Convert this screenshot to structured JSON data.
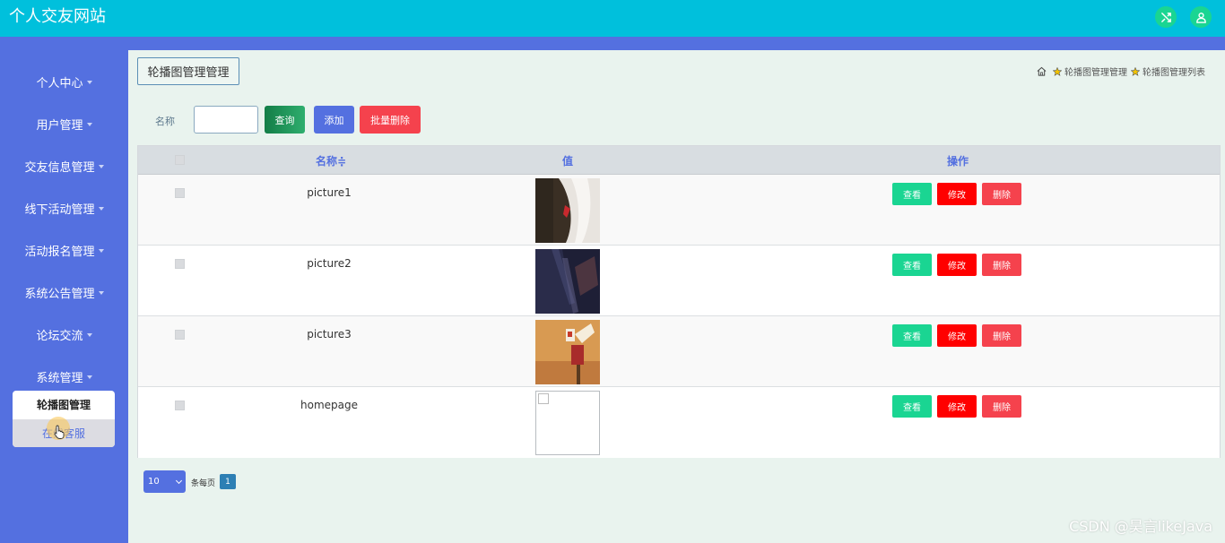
{
  "app": {
    "title": "个人交友网站"
  },
  "topbar": {
    "icons": [
      "shuffle-icon",
      "user-icon"
    ]
  },
  "sidebar": {
    "items": [
      {
        "label": "个人中心"
      },
      {
        "label": "用户管理"
      },
      {
        "label": "交友信息管理"
      },
      {
        "label": "线下活动管理"
      },
      {
        "label": "活动报名管理"
      },
      {
        "label": "系统公告管理"
      },
      {
        "label": "论坛交流"
      },
      {
        "label": "系统管理"
      }
    ],
    "submenu": {
      "active": "轮播图管理",
      "hover": "在线客服"
    }
  },
  "main": {
    "page_button": "轮播图管理管理",
    "breadcrumb": [
      "轮播图管理管理",
      "轮播图管理列表"
    ],
    "search": {
      "label": "名称",
      "value": "",
      "query": "查询",
      "add": "添加",
      "batch_delete": "批量删除"
    },
    "table": {
      "headers": {
        "name": "名称",
        "sort_icon": "≑",
        "value": "值",
        "actions": "操作"
      },
      "rows": [
        {
          "name": "picture1",
          "image": "photo"
        },
        {
          "name": "picture2",
          "image": "photo"
        },
        {
          "name": "picture3",
          "image": "photo"
        },
        {
          "name": "homepage",
          "image": "broken"
        }
      ],
      "actions": {
        "view": "查看",
        "edit": "修改",
        "delete": "删除"
      }
    },
    "pagination": {
      "page_size": "10",
      "per_page_text": "条每页",
      "current_page": "1"
    }
  },
  "watermark": "CSDN @昊言likeJava",
  "colors": {
    "topbar": "#00c0dc",
    "sidebar": "#5470e0",
    "green": "#1ad592",
    "red": "#ff0000",
    "coral": "#f5424d",
    "main_bg": "#e9f3ee"
  }
}
